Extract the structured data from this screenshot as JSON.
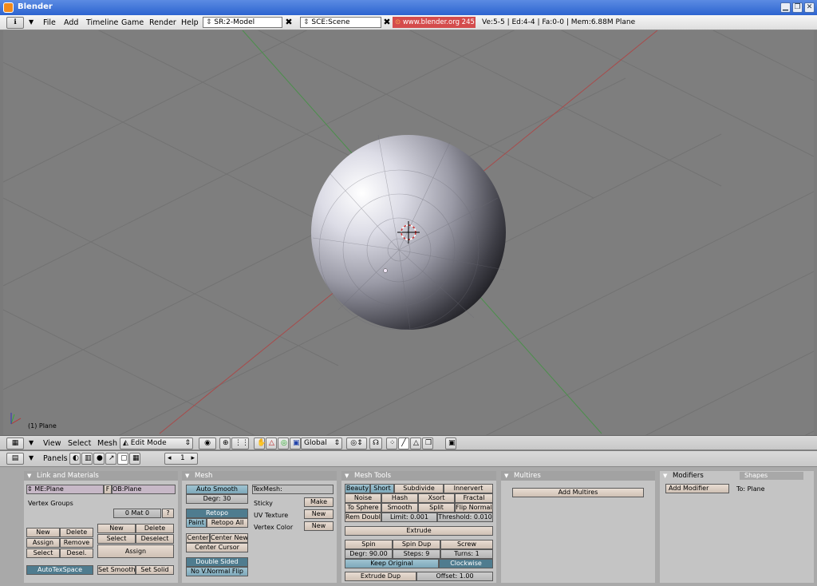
{
  "window": {
    "title": "Blender"
  },
  "menubar": {
    "menus": [
      "File",
      "Add",
      "Timeline",
      "Game",
      "Render",
      "Help"
    ],
    "screen_field": "SR:2-Model",
    "scene_field": "SCE:Scene",
    "site_link": "www.blender.org 245",
    "stats": "Ve:5-5 | Ed:4-4 | Fa:0-0 | Mem:6.88M Plane"
  },
  "viewport": {
    "object_label": "(1) Plane"
  },
  "view3d_header": {
    "menus": [
      "View",
      "Select",
      "Mesh"
    ],
    "mode": "Edit Mode",
    "orientation": "Global"
  },
  "buttons_header": {
    "label": "Panels",
    "frame": "1"
  },
  "panels": {
    "link_materials": {
      "title": "Link and Materials",
      "mesh_name": "ME:Plane",
      "f_label": "F",
      "ob_name": "OB:Plane",
      "vertex_groups": "Vertex Groups",
      "mat_counter": "0 Mat 0",
      "q": "?",
      "new": "New",
      "delete": "Delete",
      "assign": "Assign",
      "remove": "Remove",
      "select": "Select",
      "desel": "Desel.",
      "new2": "New",
      "delete2": "Delete",
      "select2": "Select",
      "deselect2": "Deselect",
      "assign2": "Assign",
      "autotexspace": "AutoTexSpace",
      "set_smooth": "Set Smooth",
      "set_solid": "Set Solid"
    },
    "mesh": {
      "title": "Mesh",
      "auto_smooth": "Auto Smooth",
      "degr": "Degr: 30",
      "retopo": "Retopo",
      "paint": "Paint",
      "retopo_all": "Retopo All",
      "center": "Center",
      "center_new": "Center New",
      "center_cursor": "Center Cursor",
      "double_sided": "Double Sided",
      "no_vnormal_flip": "No V.Normal Flip",
      "texmesh": "TexMesh:",
      "sticky": "Sticky",
      "make": "Make",
      "uv_texture": "UV Texture",
      "uv_new": "New",
      "vertex_color": "Vertex Color",
      "vc_new": "New"
    },
    "mesh_tools": {
      "title": "Mesh Tools",
      "beauty": "Beauty",
      "short": "Short",
      "subdivide": "Subdivide",
      "innervert": "Innervert",
      "noise": "Noise",
      "hash": "Hash",
      "xsort": "Xsort",
      "fractal": "Fractal",
      "to_sphere": "To Sphere",
      "smooth": "Smooth",
      "split": "Split",
      "flip_normals": "Flip Normals",
      "rem_double": "Rem Double",
      "limit": "Limit: 0.001",
      "threshold": "Threshold: 0.010",
      "extrude": "Extrude",
      "spin": "Spin",
      "spin_dup": "Spin Dup",
      "screw": "Screw",
      "degr": "Degr: 90.00",
      "steps": "Steps: 9",
      "turns": "Turns: 1",
      "keep_original": "Keep Original",
      "clockwise": "Clockwise",
      "extrude_dup": "Extrude Dup",
      "offset": "Offset: 1.00"
    },
    "multires": {
      "title": "Multires",
      "add_multires": "Add Multires"
    },
    "modifiers": {
      "tab_modifiers": "Modifiers",
      "tab_shapes": "Shapes",
      "add_modifier": "Add Modifier",
      "to": "To: Plane"
    }
  }
}
